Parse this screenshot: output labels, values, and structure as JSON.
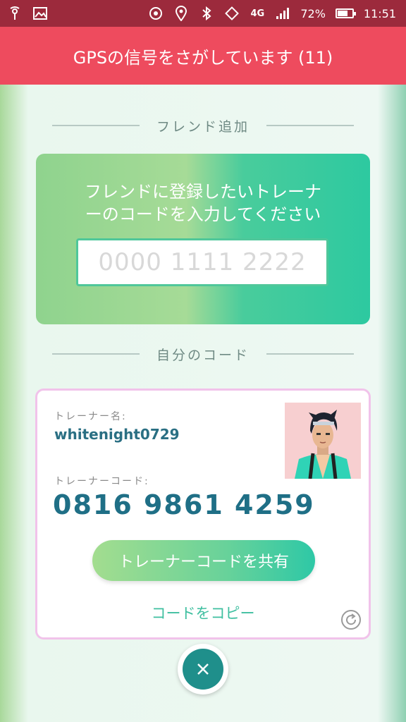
{
  "status_bar": {
    "battery_percent_text": "72%",
    "battery_level": 0.72,
    "network": "4G",
    "time": "11:51",
    "left_icons": [
      "antenna-icon",
      "image-icon"
    ],
    "right_icons": [
      "gps-icon",
      "location-pin-icon",
      "bluetooth-icon",
      "rotate-icon",
      "network-4g-icon",
      "signal-icon",
      "battery-icon"
    ]
  },
  "header": {
    "title": "GPSの信号をさがしています (11)",
    "color": "#ee4b5e"
  },
  "add_friend": {
    "section_title": "フレンド追加",
    "instruction_line1": "フレンドに登録したいトレーナ",
    "instruction_line2": "ーのコードを入力してください",
    "input_placeholder": "0000 1111 2222",
    "input_value": ""
  },
  "my_code": {
    "section_title": "自分のコード",
    "trainer_name_label": "トレーナー名:",
    "trainer_name": "whitenight0729",
    "trainer_code_label": "トレーナーコード:",
    "trainer_code": "0816 9861 4259",
    "share_button": "トレーナーコードを共有",
    "copy_link": "コードをコピー"
  },
  "colors": {
    "accent": "#2a6f83",
    "teal": "#1f8f8b",
    "card_border": "#f1c3ea"
  }
}
